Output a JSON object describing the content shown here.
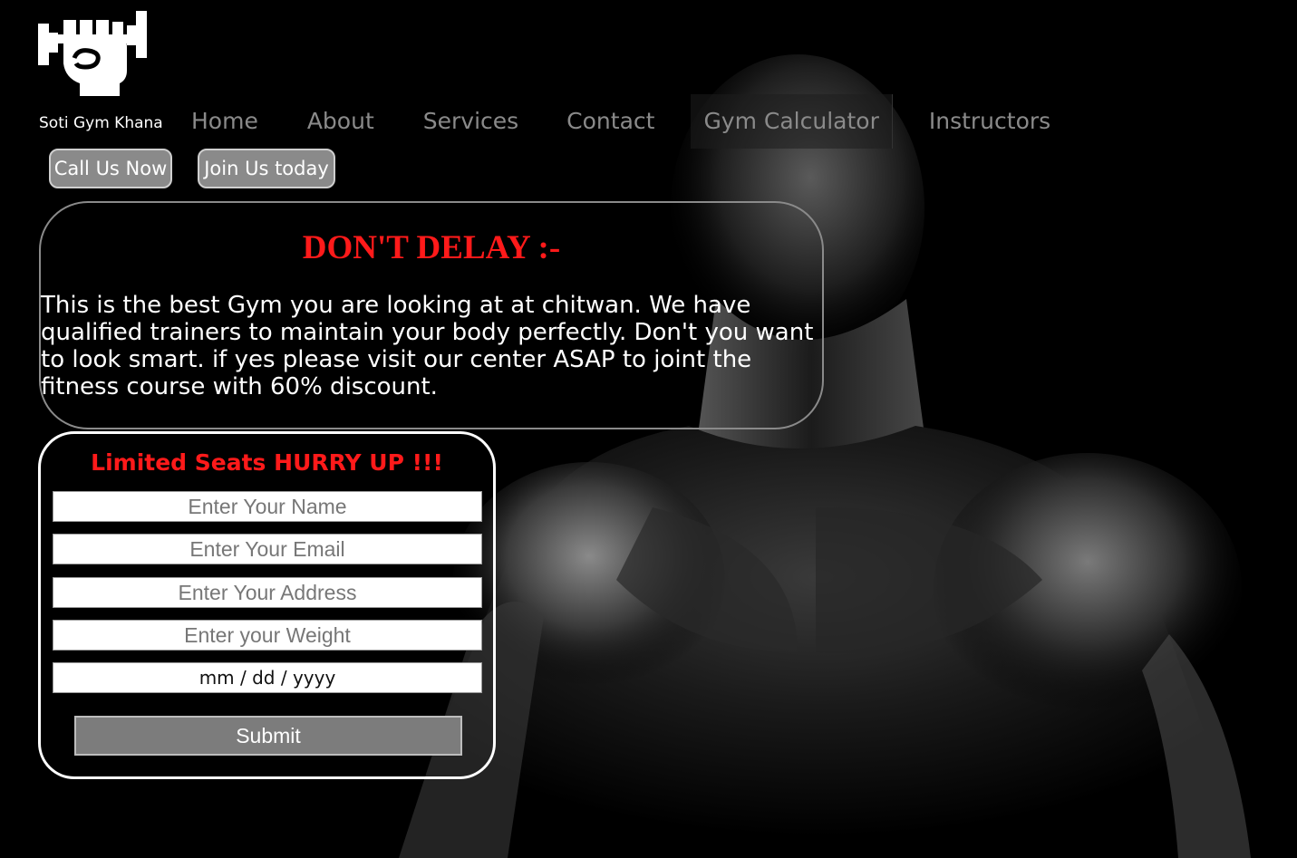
{
  "brand": {
    "name": "Soti Gym Khana",
    "logo_icon": "fist-dumbbell-icon"
  },
  "nav": {
    "items": [
      {
        "label": "Home"
      },
      {
        "label": "About"
      },
      {
        "label": "Services"
      },
      {
        "label": "Contact"
      },
      {
        "label": "Gym Calculator"
      },
      {
        "label": "Instructors"
      }
    ]
  },
  "actions": {
    "call_label": "Call Us Now",
    "join_label": "Join Us today"
  },
  "promo": {
    "title": "DON'T DELAY :-",
    "text": "This is the best Gym you are looking at at chitwan. We have qualified trainers to maintain your body perfectly. Don't you want to look smart. if yes please visit our center ASAP to joint the fitness course with 60% discount."
  },
  "form": {
    "title": "Limited Seats HURRY UP !!!",
    "name_placeholder": "Enter Your Name",
    "email_placeholder": "Enter Your Email",
    "address_placeholder": "Enter Your Address",
    "weight_placeholder": "Enter your Weight",
    "date_value": "mm / dd / yyyy",
    "submit_label": "Submit"
  },
  "colors": {
    "background": "#000000",
    "accent_red": "#ff1a1a",
    "nav_text": "#8a8a8a",
    "button_gray": "#8a8a8a"
  }
}
